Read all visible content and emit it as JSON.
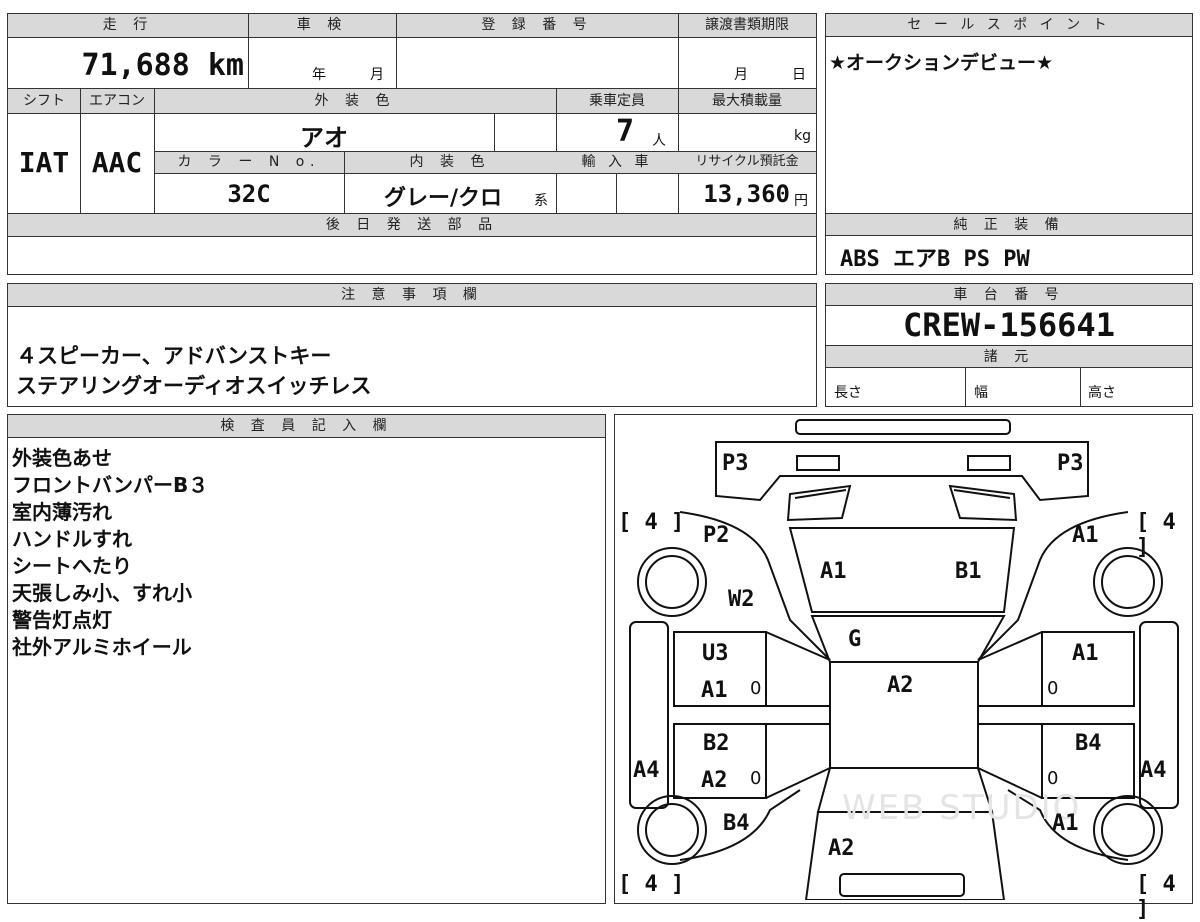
{
  "top": {
    "mileage_label": "走 行",
    "mileage_value": "71,688 km",
    "shaken_label": "車 検",
    "shaken_year": "年",
    "shaken_month": "月",
    "reg_label": "登 録 番 号",
    "doc_label": "譲渡書類期限",
    "doc_month": "月",
    "doc_day": "日",
    "shift_label": "シフト",
    "shift_value": "IAT",
    "ac_label": "エアコン",
    "ac_value": "AAC",
    "color_label": "外 装 色",
    "color_value": "アオ",
    "capacity_label": "乗車定員",
    "capacity_value": "7",
    "capacity_unit": "人",
    "load_label": "最大積載量",
    "load_unit": "kg",
    "colorno_label": "カ ラ ー N o.",
    "colorno_value": "32C",
    "interior_label": "内 装 色",
    "interior_value": "グレー/クロ",
    "interior_unit": "系",
    "import_label": "輸 入 車",
    "recycle_label": "リサイクル預託金",
    "recycle_value": "13,360",
    "recycle_unit": "円",
    "later_label": "後 日 発 送 部 品"
  },
  "sales": {
    "label": "セ ー ル ス ポ イ ン ト",
    "text": "★オークションデビュー★"
  },
  "equipment": {
    "label": "純 正 装 備",
    "text": "ABS エアB PS PW"
  },
  "notes": {
    "label": "注 意 事 項 欄",
    "line1": "４スピーカー、アドバンストキー",
    "line2": "ステアリングオーディオスイッチレス"
  },
  "chassis": {
    "label": "車 台 番 号",
    "value": "CREW-156641",
    "spec_label": "諸 元",
    "length": "長さ",
    "width": "幅",
    "height": "高さ"
  },
  "inspector": {
    "label": "検 査 員 記 入 欄",
    "lines": [
      "外装色あせ",
      "フロントバンパーB３",
      "室内薄汚れ",
      "ハンドルすれ",
      "シートへたり",
      "天張しみ小、すれ小",
      "警告灯点灯",
      "社外アルミホイール"
    ]
  },
  "diagram": {
    "p3_left": "P3",
    "p3_right": "P3",
    "tire_fl": "[ 4 ]",
    "tire_fr": "[ 4 ]",
    "tire_rl": "[ 4 ]",
    "tire_rr": "[ 4 ]",
    "p2": "P2",
    "w2": "W2",
    "a1_hood_left": "A1",
    "b1_hood": "B1",
    "a1_front_right": "A1",
    "g": "G",
    "u3": "U3",
    "a1_door_fl": "A1",
    "zero_fl": "0",
    "a2_roof": "A2",
    "a1_door_fr": "A1",
    "zero_fr": "0",
    "b2": "B2",
    "a2_door_rl": "A2",
    "zero_rl": "0",
    "b4_door_rr": "B4",
    "zero_rr": "0",
    "a4_left": "A4",
    "a4_right": "A4",
    "b4_rear_left": "B4",
    "a1_rear_right": "A1",
    "a2_rear": "A2",
    "watermark": "WEB STUDIO"
  }
}
